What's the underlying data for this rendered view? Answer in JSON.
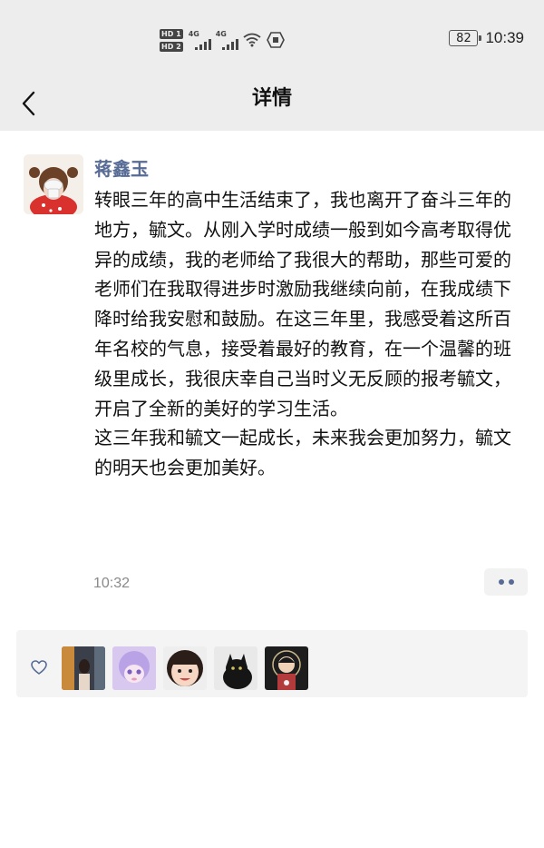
{
  "status_bar": {
    "hd_badges": [
      "HD 1",
      "HD 2"
    ],
    "net_labels": [
      "4G",
      "4G"
    ],
    "battery_level": "82",
    "time": "10:39",
    "icons": [
      "hd-icon",
      "signal-4g-icon",
      "signal-4g-icon",
      "wifi-icon",
      "hexagon-icon",
      "battery-icon"
    ]
  },
  "nav": {
    "title": "详情",
    "back_icon": "chevron-left-icon"
  },
  "post": {
    "author": "蒋鑫玉",
    "paragraphs": [
      "转眼三年的高中生活结束了，我也离开了奋斗三年的地方，毓文。从刚入学时成绩一般到如今高考取得优异的成绩，我的老师给了我很大的帮助，那些可爱的老师们在我取得进步时激励我继续向前，在我成绩下降时给我安慰和鼓励。在这三年里，我感受着这所百年名校的气息，接受着最好的教育，在一个温馨的班级里成长，我很庆幸自己当时义无反顾的报考毓文，开启了全新的美好的学习生活。",
      "这三年我和毓文一起成长，未来我会更加努力，毓文的明天也会更加美好。"
    ],
    "time": "10:32"
  },
  "likes": {
    "icon": "heart-outline-icon",
    "avatars": [
      "avatar-1",
      "avatar-2",
      "avatar-3",
      "avatar-4",
      "avatar-5"
    ]
  },
  "colors": {
    "bar_bg": "#ededed",
    "author": "#576b95",
    "time": "#8a8a8a",
    "panel_bg": "#f4f4f4"
  }
}
